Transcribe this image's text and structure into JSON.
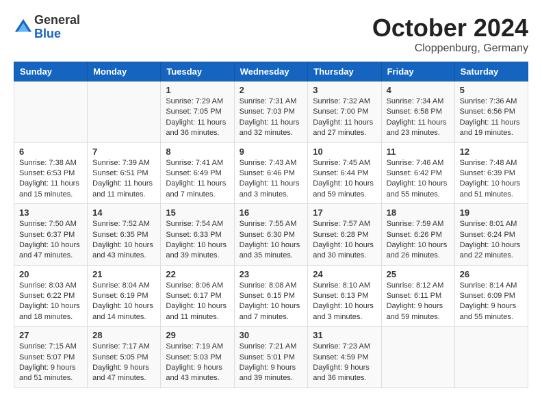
{
  "logo": {
    "general": "General",
    "blue": "Blue"
  },
  "title": "October 2024",
  "location": "Cloppenburg, Germany",
  "days_of_week": [
    "Sunday",
    "Monday",
    "Tuesday",
    "Wednesday",
    "Thursday",
    "Friday",
    "Saturday"
  ],
  "weeks": [
    [
      {
        "day": "",
        "info": ""
      },
      {
        "day": "",
        "info": ""
      },
      {
        "day": "1",
        "info": "Sunrise: 7:29 AM\nSunset: 7:05 PM\nDaylight: 11 hours and 36 minutes."
      },
      {
        "day": "2",
        "info": "Sunrise: 7:31 AM\nSunset: 7:03 PM\nDaylight: 11 hours and 32 minutes."
      },
      {
        "day": "3",
        "info": "Sunrise: 7:32 AM\nSunset: 7:00 PM\nDaylight: 11 hours and 27 minutes."
      },
      {
        "day": "4",
        "info": "Sunrise: 7:34 AM\nSunset: 6:58 PM\nDaylight: 11 hours and 23 minutes."
      },
      {
        "day": "5",
        "info": "Sunrise: 7:36 AM\nSunset: 6:56 PM\nDaylight: 11 hours and 19 minutes."
      }
    ],
    [
      {
        "day": "6",
        "info": "Sunrise: 7:38 AM\nSunset: 6:53 PM\nDaylight: 11 hours and 15 minutes."
      },
      {
        "day": "7",
        "info": "Sunrise: 7:39 AM\nSunset: 6:51 PM\nDaylight: 11 hours and 11 minutes."
      },
      {
        "day": "8",
        "info": "Sunrise: 7:41 AM\nSunset: 6:49 PM\nDaylight: 11 hours and 7 minutes."
      },
      {
        "day": "9",
        "info": "Sunrise: 7:43 AM\nSunset: 6:46 PM\nDaylight: 11 hours and 3 minutes."
      },
      {
        "day": "10",
        "info": "Sunrise: 7:45 AM\nSunset: 6:44 PM\nDaylight: 10 hours and 59 minutes."
      },
      {
        "day": "11",
        "info": "Sunrise: 7:46 AM\nSunset: 6:42 PM\nDaylight: 10 hours and 55 minutes."
      },
      {
        "day": "12",
        "info": "Sunrise: 7:48 AM\nSunset: 6:39 PM\nDaylight: 10 hours and 51 minutes."
      }
    ],
    [
      {
        "day": "13",
        "info": "Sunrise: 7:50 AM\nSunset: 6:37 PM\nDaylight: 10 hours and 47 minutes."
      },
      {
        "day": "14",
        "info": "Sunrise: 7:52 AM\nSunset: 6:35 PM\nDaylight: 10 hours and 43 minutes."
      },
      {
        "day": "15",
        "info": "Sunrise: 7:54 AM\nSunset: 6:33 PM\nDaylight: 10 hours and 39 minutes."
      },
      {
        "day": "16",
        "info": "Sunrise: 7:55 AM\nSunset: 6:30 PM\nDaylight: 10 hours and 35 minutes."
      },
      {
        "day": "17",
        "info": "Sunrise: 7:57 AM\nSunset: 6:28 PM\nDaylight: 10 hours and 30 minutes."
      },
      {
        "day": "18",
        "info": "Sunrise: 7:59 AM\nSunset: 6:26 PM\nDaylight: 10 hours and 26 minutes."
      },
      {
        "day": "19",
        "info": "Sunrise: 8:01 AM\nSunset: 6:24 PM\nDaylight: 10 hours and 22 minutes."
      }
    ],
    [
      {
        "day": "20",
        "info": "Sunrise: 8:03 AM\nSunset: 6:22 PM\nDaylight: 10 hours and 18 minutes."
      },
      {
        "day": "21",
        "info": "Sunrise: 8:04 AM\nSunset: 6:19 PM\nDaylight: 10 hours and 14 minutes."
      },
      {
        "day": "22",
        "info": "Sunrise: 8:06 AM\nSunset: 6:17 PM\nDaylight: 10 hours and 11 minutes."
      },
      {
        "day": "23",
        "info": "Sunrise: 8:08 AM\nSunset: 6:15 PM\nDaylight: 10 hours and 7 minutes."
      },
      {
        "day": "24",
        "info": "Sunrise: 8:10 AM\nSunset: 6:13 PM\nDaylight: 10 hours and 3 minutes."
      },
      {
        "day": "25",
        "info": "Sunrise: 8:12 AM\nSunset: 6:11 PM\nDaylight: 9 hours and 59 minutes."
      },
      {
        "day": "26",
        "info": "Sunrise: 8:14 AM\nSunset: 6:09 PM\nDaylight: 9 hours and 55 minutes."
      }
    ],
    [
      {
        "day": "27",
        "info": "Sunrise: 7:15 AM\nSunset: 5:07 PM\nDaylight: 9 hours and 51 minutes."
      },
      {
        "day": "28",
        "info": "Sunrise: 7:17 AM\nSunset: 5:05 PM\nDaylight: 9 hours and 47 minutes."
      },
      {
        "day": "29",
        "info": "Sunrise: 7:19 AM\nSunset: 5:03 PM\nDaylight: 9 hours and 43 minutes."
      },
      {
        "day": "30",
        "info": "Sunrise: 7:21 AM\nSunset: 5:01 PM\nDaylight: 9 hours and 39 minutes."
      },
      {
        "day": "31",
        "info": "Sunrise: 7:23 AM\nSunset: 4:59 PM\nDaylight: 9 hours and 36 minutes."
      },
      {
        "day": "",
        "info": ""
      },
      {
        "day": "",
        "info": ""
      }
    ]
  ]
}
